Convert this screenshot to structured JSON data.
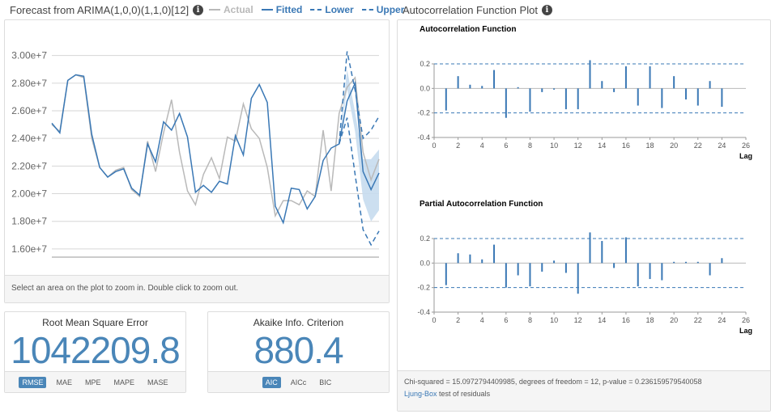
{
  "forecast_header": {
    "title": "Forecast from ARIMA(1,0,0)(1,1,0)[12]",
    "info_icon": "info-icon",
    "legend": [
      {
        "label": "Actual",
        "color": "#b9b9b9",
        "style": "solid"
      },
      {
        "label": "Fitted",
        "color": "#3a78b5",
        "style": "solid"
      },
      {
        "label": "Lower",
        "color": "#3a78b5",
        "style": "dashed"
      },
      {
        "label": "Upper",
        "color": "#3a78b5",
        "style": "dashed"
      }
    ]
  },
  "forecast_footer": "Select an area on the plot to zoom in. Double click to zoom out.",
  "forecast_chart": {
    "type": "line",
    "y_ticks": [
      "3.00e+7",
      "2.80e+7",
      "2.60e+7",
      "2.40e+7",
      "2.20e+7",
      "2.00e+7",
      "1.80e+7",
      "1.60e+7"
    ],
    "ylim": [
      15000000,
      31500000
    ],
    "x_count": 42,
    "actual": [
      25.0,
      24.5,
      28.2,
      28.6,
      28.4,
      24.0,
      21.9,
      21.2,
      21.7,
      21.9,
      20.3,
      19.8,
      23.8,
      21.6,
      24.4,
      26.8,
      23.0,
      20.2,
      19.2,
      21.4,
      22.6,
      21.1,
      24.1,
      23.8,
      26.5,
      24.7,
      24.0,
      21.9,
      18.4,
      19.5,
      19.5,
      19.2,
      20.2,
      19.8,
      24.6,
      20.2,
      25.8,
      27.7,
      28.4,
      23.0,
      21.0,
      22.5
    ],
    "fitted": [
      25.1,
      24.4,
      28.2,
      28.6,
      28.5,
      24.3,
      21.9,
      21.2,
      21.6,
      21.8,
      20.4,
      19.9,
      23.6,
      22.3,
      25.2,
      24.6,
      25.8,
      24.1,
      20.1,
      20.6,
      20.1,
      20.9,
      20.7,
      24.2,
      22.8,
      26.9,
      27.9,
      26.6,
      19.1,
      17.9,
      20.4,
      20.3,
      18.9,
      19.8,
      22.4,
      23.3,
      23.6,
      26.7,
      28.0,
      21.6,
      20.3,
      21.5
    ],
    "forecast_start_index": 37,
    "lower": [
      null,
      null,
      null,
      null,
      null,
      null,
      null,
      null,
      null,
      null,
      null,
      null,
      null,
      null,
      null,
      null,
      null,
      null,
      null,
      null,
      null,
      null,
      null,
      null,
      null,
      null,
      null,
      null,
      null,
      null,
      null,
      null,
      null,
      null,
      null,
      null,
      null,
      25.5,
      21.4,
      17.4,
      16.3,
      17.3
    ],
    "upper": [
      null,
      null,
      null,
      null,
      null,
      null,
      null,
      null,
      null,
      null,
      null,
      null,
      null,
      null,
      null,
      null,
      null,
      null,
      null,
      null,
      null,
      null,
      null,
      null,
      null,
      null,
      null,
      null,
      null,
      null,
      null,
      null,
      null,
      null,
      null,
      null,
      null,
      30.3,
      27.5,
      24.0,
      24.6,
      25.6
    ],
    "band_lower": [
      null,
      null,
      null,
      null,
      null,
      null,
      null,
      null,
      null,
      null,
      null,
      null,
      null,
      null,
      null,
      null,
      null,
      null,
      null,
      null,
      null,
      null,
      null,
      null,
      null,
      null,
      null,
      null,
      null,
      null,
      null,
      null,
      null,
      null,
      null,
      null,
      null,
      27.6,
      24.5,
      19.6,
      18.0,
      18.8
    ],
    "band_upper": [
      null,
      null,
      null,
      null,
      null,
      null,
      null,
      null,
      null,
      null,
      null,
      null,
      null,
      null,
      null,
      null,
      null,
      null,
      null,
      null,
      null,
      null,
      null,
      null,
      null,
      null,
      null,
      null,
      null,
      null,
      null,
      null,
      null,
      null,
      null,
      null,
      null,
      29.0,
      25.9,
      22.5,
      22.5,
      23.2
    ],
    "band_color": "#c6dcee"
  },
  "metrics": {
    "rmse": {
      "title": "Root Mean Square Error",
      "value": "1042209.8",
      "tabs": [
        "RMSE",
        "MAE",
        "MPE",
        "MAPE",
        "MASE"
      ],
      "active_tab": "RMSE"
    },
    "aic": {
      "title": "Akaike Info. Criterion",
      "value": "880.4",
      "tabs": [
        "AIC",
        "AICc",
        "BIC"
      ],
      "active_tab": "AIC"
    }
  },
  "acf_header": {
    "title": "Autocorrelation Function Plot",
    "info_icon": "info-icon"
  },
  "chart_data": [
    {
      "type": "bar",
      "title": "Autocorrelation Function",
      "xlabel": "Lag",
      "x": [
        1,
        2,
        3,
        4,
        5,
        6,
        7,
        8,
        9,
        10,
        11,
        12,
        13,
        14,
        15,
        16,
        17,
        18,
        19,
        20,
        21,
        22,
        23,
        24
      ],
      "values": [
        -0.18,
        0.1,
        0.03,
        0.02,
        0.15,
        -0.24,
        0.01,
        -0.19,
        -0.03,
        -0.01,
        -0.17,
        -0.17,
        0.23,
        0.06,
        -0.03,
        0.18,
        -0.14,
        0.18,
        -0.16,
        0.1,
        -0.09,
        -0.14,
        0.06,
        -0.15
      ],
      "conf_limit": 0.2,
      "xlim": [
        0,
        26
      ],
      "ylim": [
        -0.4,
        0.2
      ],
      "x_ticks": [
        "0",
        "2",
        "4",
        "6",
        "8",
        "10",
        "12",
        "14",
        "16",
        "18",
        "20",
        "22",
        "24",
        "26"
      ],
      "y_ticks": [
        "0.2",
        "0.0",
        "-0.2",
        "-0.4"
      ]
    },
    {
      "type": "bar",
      "title": "Partial Autocorrelation Function",
      "xlabel": "Lag",
      "x": [
        1,
        2,
        3,
        4,
        5,
        6,
        7,
        8,
        9,
        10,
        11,
        12,
        13,
        14,
        15,
        16,
        17,
        18,
        19,
        20,
        21,
        22,
        23,
        24
      ],
      "values": [
        -0.18,
        0.08,
        0.07,
        0.03,
        0.15,
        -0.2,
        -0.1,
        -0.19,
        -0.07,
        0.02,
        -0.08,
        -0.25,
        0.25,
        0.18,
        -0.04,
        0.21,
        -0.19,
        -0.13,
        -0.14,
        0.01,
        0.01,
        0.01,
        -0.1,
        0.04
      ],
      "conf_limit": 0.2,
      "xlim": [
        0,
        26
      ],
      "ylim": [
        -0.4,
        0.2
      ],
      "x_ticks": [
        "0",
        "2",
        "4",
        "6",
        "8",
        "10",
        "12",
        "14",
        "16",
        "18",
        "20",
        "22",
        "24",
        "26"
      ],
      "y_ticks": [
        "0.2",
        "0.0",
        "-0.2",
        "-0.4"
      ]
    }
  ],
  "acf_footer": {
    "stats": "Chi-squared = 15.0972794409985, degrees of freedom = 12, p-value = 0.236159579540058",
    "link": "Ljung-Box",
    "link_suffix": " test of residuals"
  }
}
